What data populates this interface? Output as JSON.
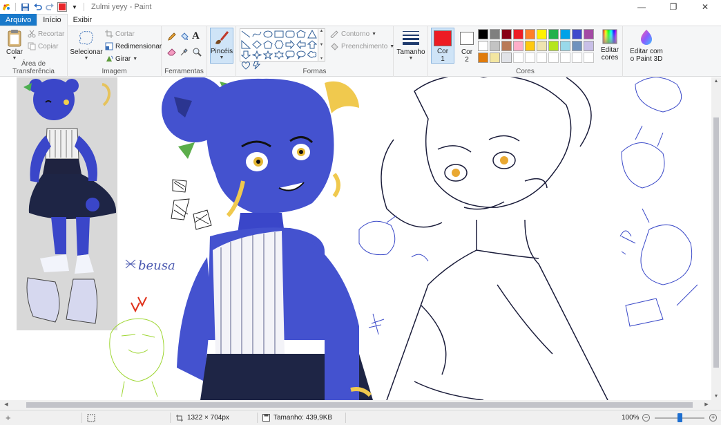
{
  "window": {
    "title": "Zulmi yeyy - Paint",
    "controls": {
      "minimize": "—",
      "maximize": "❐",
      "close": "✕"
    }
  },
  "quick_access": {
    "icons": [
      "paint-icon",
      "save-icon",
      "undo-icon",
      "redo-icon",
      "color-swatch-icon",
      "dropdown-icon"
    ],
    "swatch_color": "#e8262a"
  },
  "tabs": [
    {
      "label": "Arquivo",
      "state": "file"
    },
    {
      "label": "Início",
      "state": "active"
    },
    {
      "label": "Exibir",
      "state": "normal"
    }
  ],
  "ribbon": {
    "clipboard": {
      "label": "Área de Transferência",
      "paste": "Colar",
      "cut": "Recortar",
      "copy": "Copiar"
    },
    "image": {
      "label": "Imagem",
      "select": "Selecionar",
      "crop": "Cortar",
      "resize": "Redimensionar",
      "rotate": "Girar"
    },
    "tools": {
      "label": "Ferramentas"
    },
    "brushes": {
      "label": "Pincéis"
    },
    "shapes": {
      "label": "Formas",
      "outline": "Contorno",
      "fill": "Preenchimento"
    },
    "size": {
      "label": "Tamanho"
    },
    "colors": {
      "label": "Cores",
      "color1_label": "Cor",
      "color1_num": "1",
      "color2_label": "Cor",
      "color2_num": "2",
      "color1_value": "#ed1c24",
      "color2_value": "#ffffff",
      "edit_colors_line1": "Editar",
      "edit_colors_line2": "cores",
      "palette_row1": [
        "#000000",
        "#7f7f7f",
        "#880015",
        "#ed1c24",
        "#ff7f27",
        "#fff200",
        "#22b14c",
        "#00a2e8",
        "#3f48cc",
        "#a349a4"
      ],
      "palette_row2": [
        "#ffffff",
        "#c3c3c3",
        "#b97a57",
        "#ffaec9",
        "#ffc90e",
        "#efe4b0",
        "#b5e61d",
        "#99d9ea",
        "#7092be",
        "#c8bfe7"
      ],
      "palette_row3": [
        "#e07b0c",
        "#f3e6a1",
        "#e1e3e8",
        "empty",
        "empty",
        "empty",
        "empty",
        "empty",
        "empty",
        "empty"
      ]
    },
    "paint3d": {
      "line1": "Editar com",
      "line2": "o Paint 3D"
    }
  },
  "canvas": {
    "sketch_text": "beusa"
  },
  "statusbar": {
    "dimensions": "1322 × 704px",
    "size": "Tamanho: 439,9KB",
    "zoom": "100%",
    "zoom_level_fraction": 0.5
  }
}
